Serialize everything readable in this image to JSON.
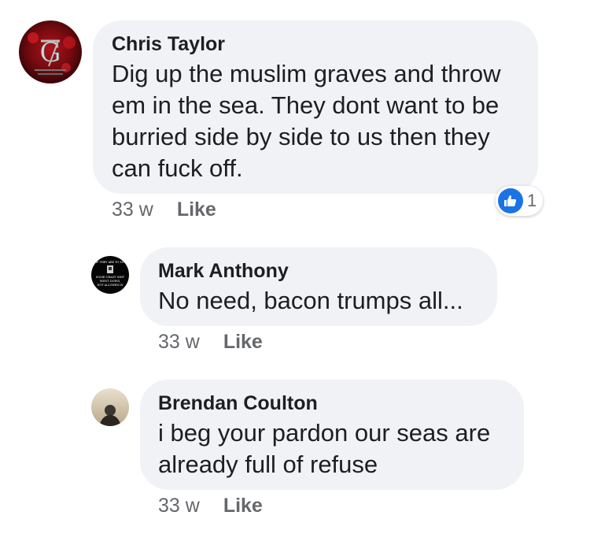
{
  "comments": [
    {
      "author": "Chris Taylor",
      "text": "Dig up the muslim graves and throw em in the sea. They dont want to be burried side by side to us then they can fuck off.",
      "time": "33 w",
      "like_label": "Like",
      "reaction_count": "1",
      "avatar_letter": "G"
    },
    {
      "author": "Mark Anthony",
      "text": "No need, bacon trumps all...",
      "time": "33 w",
      "like_label": "Like",
      "avatar_lines": [
        "IF THEY ARE TO SIT",
        "SOME CRAZY SHIT",
        "WENT DOWN,",
        "NOT ALLOWED IN"
      ]
    },
    {
      "author": "Brendan Coulton",
      "text": "i beg your pardon our seas are already full of refuse",
      "time": "33 w",
      "like_label": "Like"
    }
  ],
  "colors": {
    "bubble": "#f0f2f5",
    "meta": "#65676b",
    "like_blue": "#1b74e4"
  },
  "icons": {
    "reaction": "thumbs-up-icon"
  }
}
